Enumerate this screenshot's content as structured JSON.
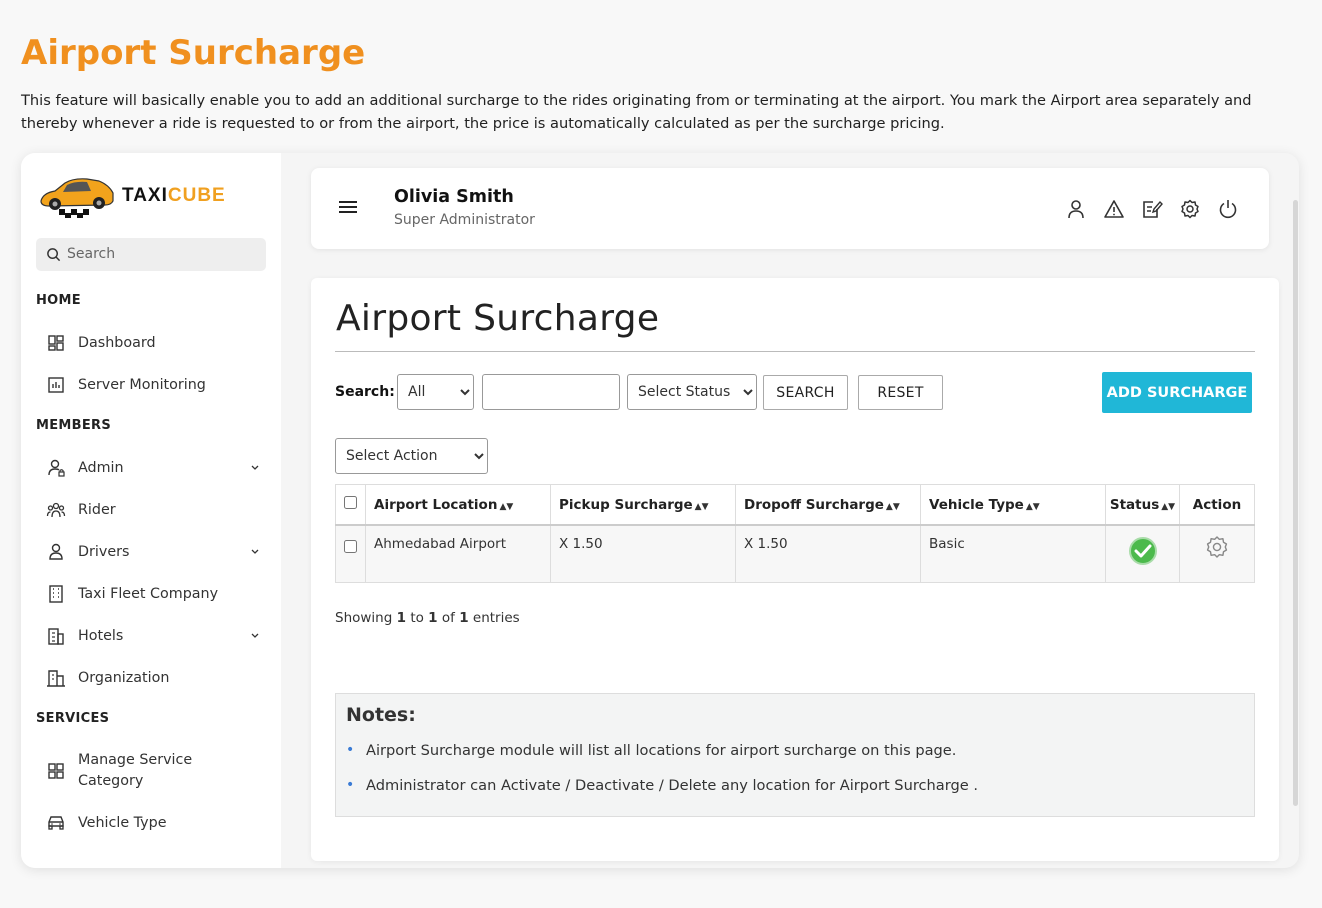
{
  "intro": {
    "title": "Airport Surcharge",
    "description": "This feature will basically enable you to add an additional surcharge to the rides originating from or terminating at the airport. You mark the Airport area separately and thereby whenever a ride is requested to or from the airport, the price is automatically calculated as per the surcharge pricing."
  },
  "brand": {
    "part1": "TAXI",
    "part2": "CUBE"
  },
  "sidebar": {
    "search_placeholder": "Search",
    "sections": [
      {
        "title": "HOME"
      },
      {
        "title": "MEMBERS"
      },
      {
        "title": "SERVICES"
      }
    ],
    "items": [
      {
        "label": "Dashboard",
        "icon": "dashboard-icon"
      },
      {
        "label": "Server Monitoring",
        "icon": "monitor-chart-icon"
      },
      {
        "label": "Admin",
        "icon": "admin-icon",
        "expandable": true
      },
      {
        "label": "Rider",
        "icon": "riders-icon"
      },
      {
        "label": "Drivers",
        "icon": "driver-icon",
        "expandable": true
      },
      {
        "label": "Taxi Fleet Company",
        "icon": "building-icon"
      },
      {
        "label": "Hotels",
        "icon": "hotel-icon",
        "expandable": true
      },
      {
        "label": "Organization",
        "icon": "organization-icon"
      },
      {
        "label": "Manage Service Category",
        "icon": "grid-icon"
      },
      {
        "label": "Vehicle Type",
        "icon": "car-icon"
      }
    ]
  },
  "topbar": {
    "user_name": "Olivia Smith",
    "user_role": "Super Administrator",
    "icons": [
      "user-icon",
      "alert-icon",
      "edit-icon",
      "settings-icon",
      "power-icon"
    ]
  },
  "page": {
    "title": "Airport Surcharge",
    "search_label": "Search:",
    "filter_all": "All",
    "filter_status": "Select Status",
    "search_button": "SEARCH",
    "reset_button": "RESET",
    "add_button": "ADD SURCHARGE",
    "select_action": "Select Action"
  },
  "table": {
    "headers": [
      "Airport Location",
      "Pickup Surcharge",
      "Dropoff Surcharge",
      "Vehicle Type",
      "Status",
      "Action"
    ],
    "rows": [
      {
        "airport_location": "Ahmedabad Airport",
        "pickup_surcharge": "X 1.50",
        "dropoff_surcharge": "X 1.50",
        "vehicle_type": "Basic",
        "status": "active"
      }
    ]
  },
  "pagination": {
    "prefix": "Showing",
    "from": "1",
    "to_word": "to",
    "to": "1",
    "of_word": "of",
    "total": "1",
    "suffix": "entries"
  },
  "notes": {
    "title": "Notes:",
    "items": [
      "Airport Surcharge module will list all locations for airport surcharge on this page.",
      "Administrator can Activate / Deactivate / Delete any location for Airport Surcharge ."
    ]
  },
  "colors": {
    "accent_orange": "#f0901f",
    "add_button": "#20b7d7",
    "status_green": "#4cba4c"
  }
}
